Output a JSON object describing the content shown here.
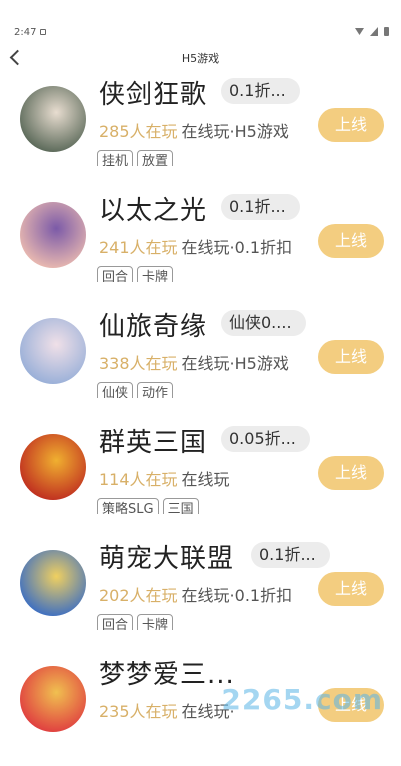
{
  "status": {
    "time": "2:47"
  },
  "nav": {
    "title": "H5游戏"
  },
  "colors": {
    "accent": "#d8b068",
    "button": "#f1c56a",
    "tag_border": "#999999"
  },
  "games": [
    {
      "title": "侠剑狂歌",
      "discount": "0.1折...",
      "players": "285人在玩",
      "mode": "在线玩·H5游戏",
      "tags": [
        "挂机",
        "放置"
      ],
      "button": "上线",
      "avatar_colors": [
        "#5c6a5a",
        "#e8ddd0"
      ]
    },
    {
      "title": "以太之光",
      "discount": "0.1折...",
      "players": "241人在玩",
      "mode": "在线玩·0.1折扣",
      "tags": [
        "回合",
        "卡牌"
      ],
      "button": "上线",
      "avatar_colors": [
        "#e8b8b0",
        "#7b5aa8"
      ]
    },
    {
      "title": "仙旅奇缘",
      "discount": "仙侠0....",
      "players": "338人在玩",
      "mode": "在线玩·H5游戏",
      "tags": [
        "仙侠",
        "动作"
      ],
      "button": "上线",
      "avatar_colors": [
        "#9ab0d8",
        "#f0e0e8"
      ]
    },
    {
      "title": "群英三国",
      "discount": "0.05折...",
      "players": "114人在玩",
      "mode": "在线玩",
      "tags": [
        "策略SLG",
        "三国"
      ],
      "button": "上线",
      "avatar_colors": [
        "#c03020",
        "#f0b030"
      ]
    },
    {
      "title": "萌宠大联盟",
      "discount": "0.1折...",
      "players": "202人在玩",
      "mode": "在线玩·0.1折扣",
      "tags": [
        "回合",
        "卡牌"
      ],
      "button": "上线",
      "avatar_colors": [
        "#4070c0",
        "#f0d060"
      ]
    },
    {
      "title": "梦梦爱三...",
      "discount": "",
      "players": "235人在玩",
      "mode": "在线玩·",
      "tags": [],
      "button": "上线",
      "avatar_colors": [
        "#e04040",
        "#f0c050"
      ]
    }
  ],
  "watermark": "2265.com"
}
